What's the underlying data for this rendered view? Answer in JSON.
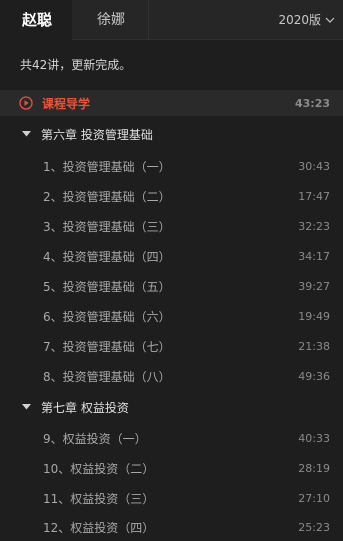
{
  "tabs": [
    {
      "label": "赵聪"
    },
    {
      "label": "徐娜"
    }
  ],
  "version": {
    "label": "2020版"
  },
  "summary": "共42讲，更新完成。",
  "intro": {
    "label": "课程导学",
    "duration": "43:23",
    "accent": "#e8533a"
  },
  "chapters": [
    {
      "title": "第六章 投资管理基础",
      "lessons": [
        {
          "label": "1、投资管理基础（一）",
          "duration": "30:43"
        },
        {
          "label": "2、投资管理基础（二）",
          "duration": "17:47"
        },
        {
          "label": "3、投资管理基础（三）",
          "duration": "32:23"
        },
        {
          "label": "4、投资管理基础（四）",
          "duration": "34:17"
        },
        {
          "label": "5、投资管理基础（五）",
          "duration": "39:27"
        },
        {
          "label": "6、投资管理基础（六）",
          "duration": "19:49"
        },
        {
          "label": "7、投资管理基础（七）",
          "duration": "21:38"
        },
        {
          "label": "8、投资管理基础（八）",
          "duration": "49:36"
        }
      ]
    },
    {
      "title": "第七章 权益投资",
      "lessons": [
        {
          "label": "9、权益投资（一）",
          "duration": "40:33"
        },
        {
          "label": "10、权益投资（二）",
          "duration": "28:19"
        },
        {
          "label": "11、权益投资（三）",
          "duration": "27:10"
        },
        {
          "label": "12、权益投资（四）",
          "duration": "25:23"
        }
      ]
    }
  ]
}
